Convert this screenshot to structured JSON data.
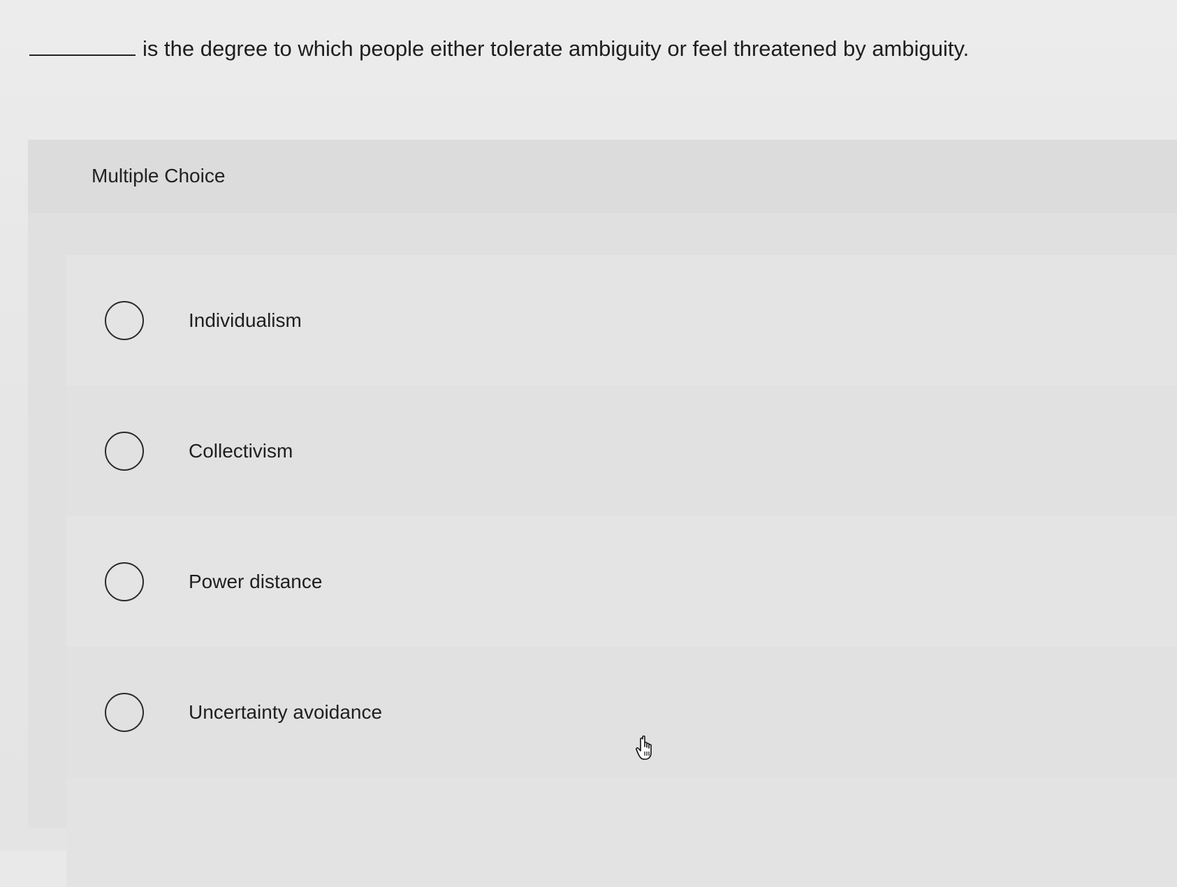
{
  "question": {
    "text": "is the degree to which people either tolerate ambiguity or feel threatened by ambiguity."
  },
  "section": {
    "label": "Multiple Choice"
  },
  "options": [
    {
      "label": "Individualism",
      "selected": false
    },
    {
      "label": "Collectivism",
      "selected": false
    },
    {
      "label": "Power distance",
      "selected": false
    },
    {
      "label": "Uncertainty avoidance",
      "selected": false
    }
  ],
  "icons": {
    "cursor": "hand-pointer-icon"
  }
}
